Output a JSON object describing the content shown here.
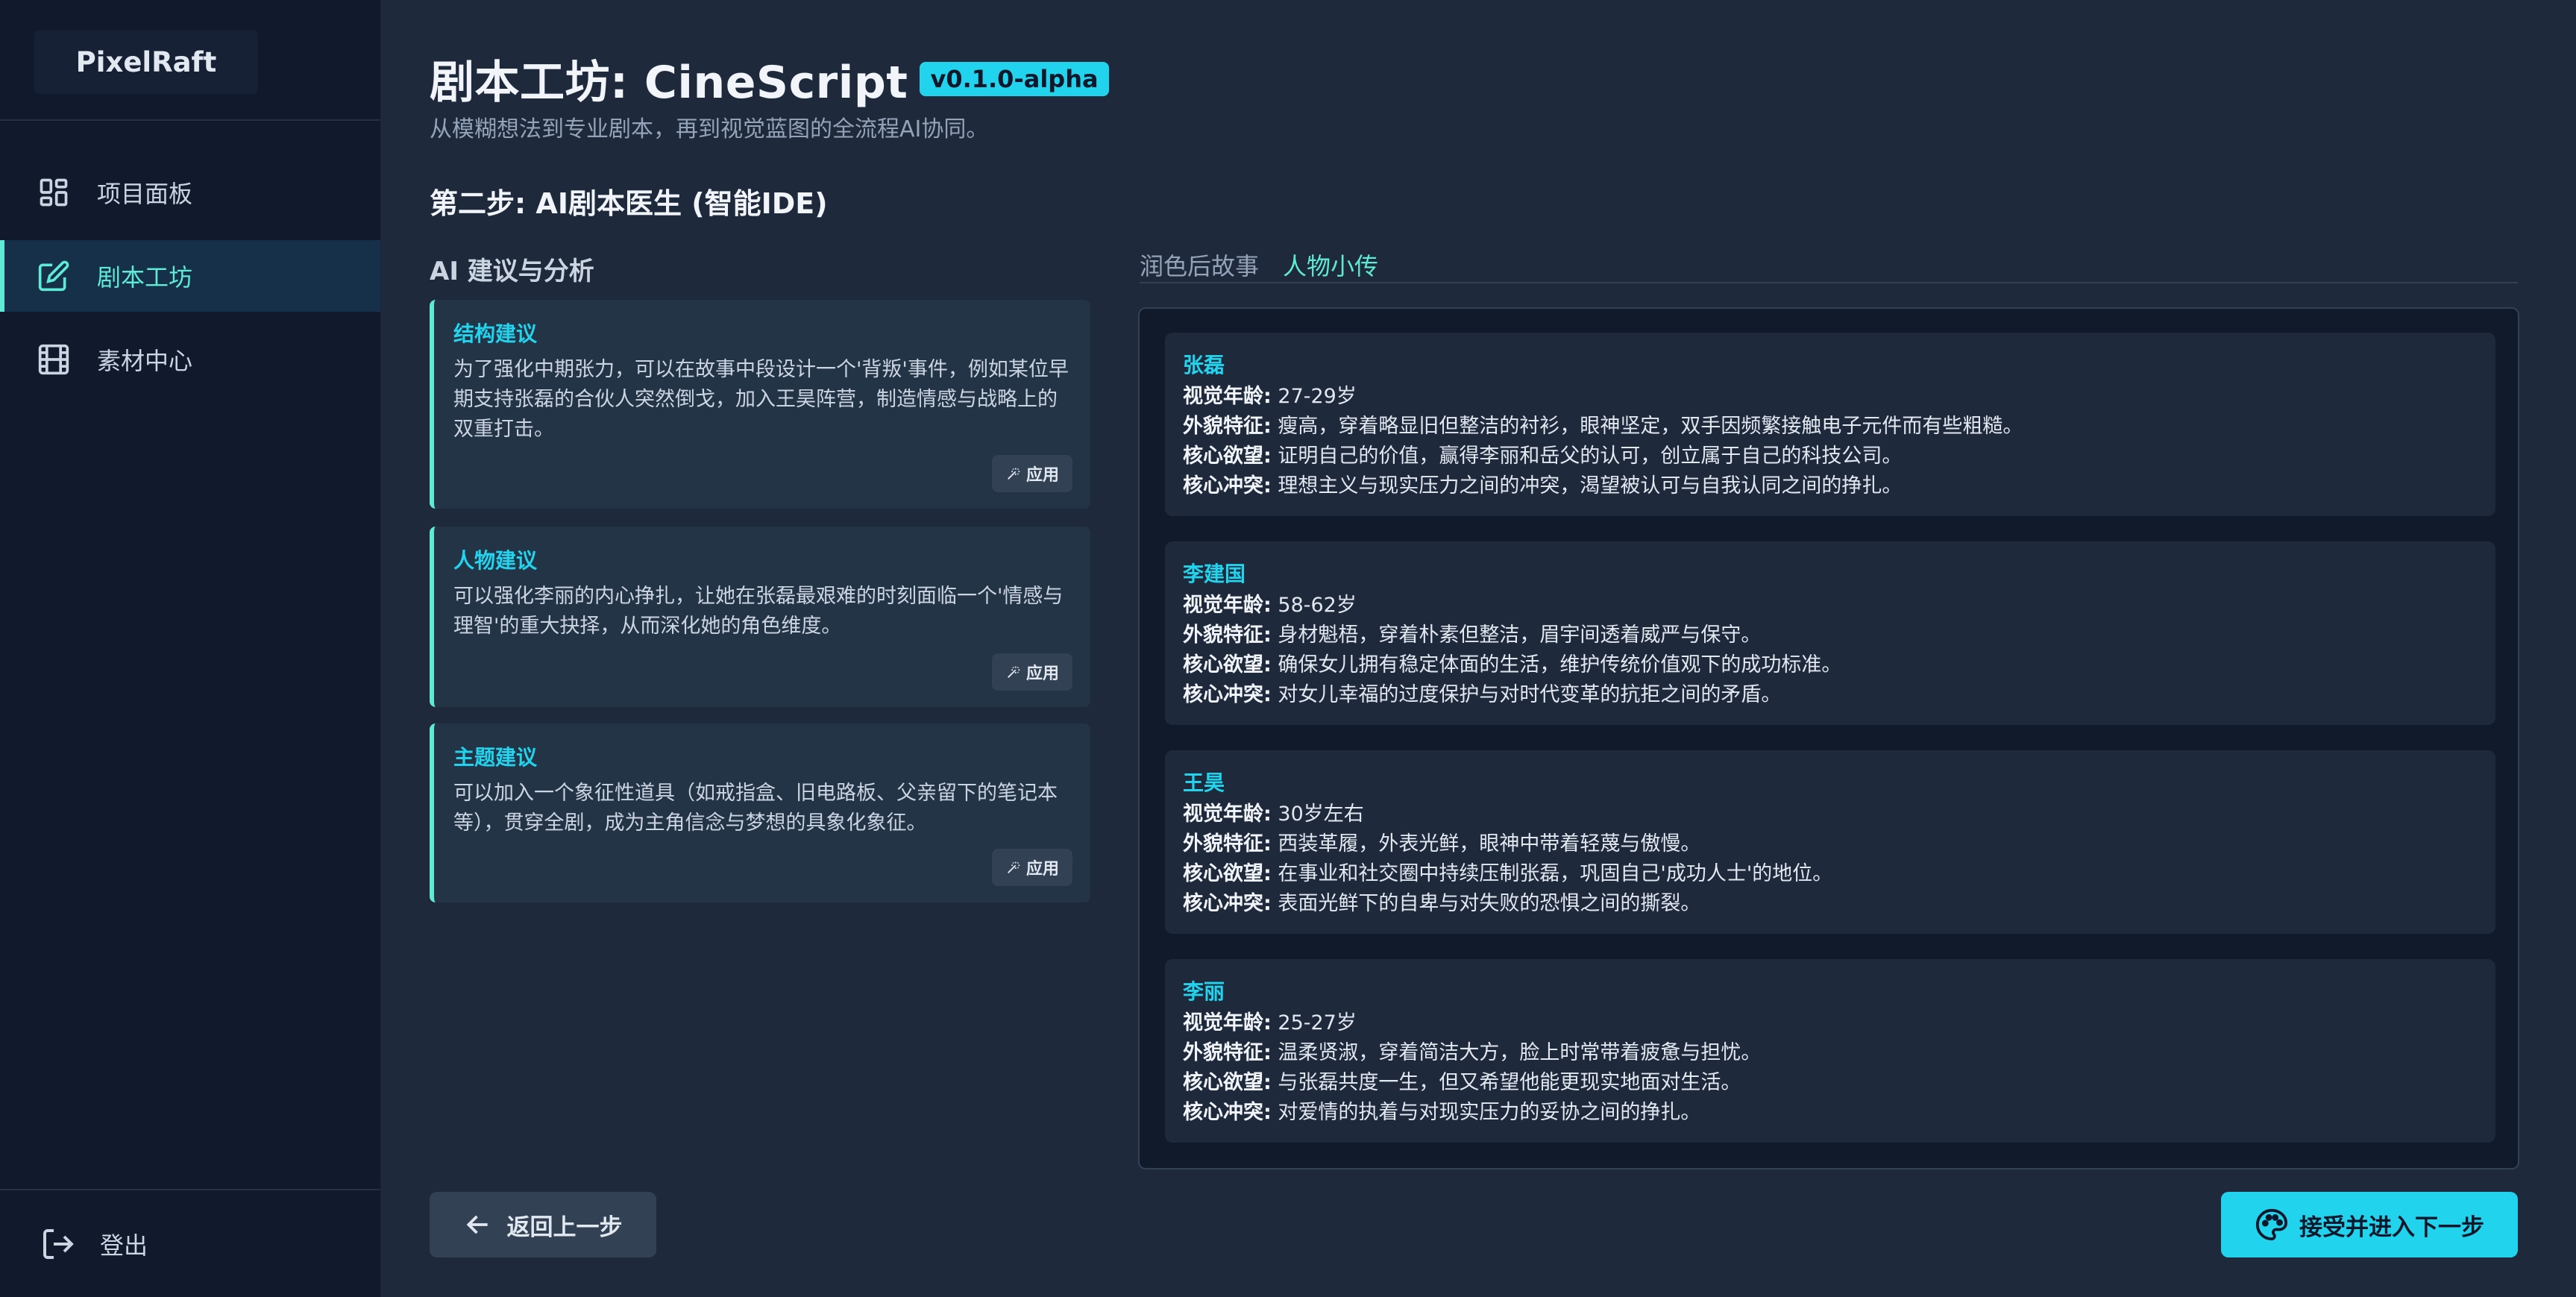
{
  "app": {
    "name": "PixelRaft"
  },
  "sidebar": {
    "items": [
      {
        "label": "项目面板",
        "icon": "dashboard-icon"
      },
      {
        "label": "剧本工坊",
        "icon": "edit-icon",
        "active": true
      },
      {
        "label": "素材中心",
        "icon": "film-icon"
      }
    ],
    "logout_label": "登出"
  },
  "header": {
    "title": "剧本工坊: CineScript",
    "version": "v0.1.0-alpha",
    "subtitle": "从模糊想法到专业剧本，再到视觉蓝图的全流程AI协同。"
  },
  "step": {
    "title": "第二步: AI剧本医生 (智能IDE)"
  },
  "suggestions": {
    "heading": "AI 建议与分析",
    "apply_label": "应用",
    "items": [
      {
        "title": "结构建议",
        "body": "为了强化中期张力，可以在故事中段设计一个'背叛'事件，例如某位早期支持张磊的合伙人突然倒戈，加入王昊阵营，制造情感与战略上的双重打击。"
      },
      {
        "title": "人物建议",
        "body": "可以强化李丽的内心挣扎，让她在张磊最艰难的时刻面临一个'情感与理智'的重大抉择，从而深化她的角色维度。"
      },
      {
        "title": "主题建议",
        "body": "可以加入一个象征性道具（如戒指盒、旧电路板、父亲留下的笔记本等），贯穿全剧，成为主角信念与梦想的具象化象征。"
      }
    ]
  },
  "tabs": [
    {
      "label": "润色后故事",
      "active": false
    },
    {
      "label": "人物小传",
      "active": true
    }
  ],
  "field_labels": {
    "age": "视觉年龄:",
    "look": "外貌特征:",
    "desire": "核心欲望:",
    "conflict": "核心冲突:"
  },
  "characters": [
    {
      "name": "张磊",
      "age": "27-29岁",
      "look": "瘦高，穿着略显旧但整洁的衬衫，眼神坚定，双手因频繁接触电子元件而有些粗糙。",
      "desire": "证明自己的价值，赢得李丽和岳父的认可，创立属于自己的科技公司。",
      "conflict": "理想主义与现实压力之间的冲突，渴望被认可与自我认同之间的挣扎。"
    },
    {
      "name": "李建国",
      "age": "58-62岁",
      "look": "身材魁梧，穿着朴素但整洁，眉宇间透着威严与保守。",
      "desire": "确保女儿拥有稳定体面的生活，维护传统价值观下的成功标准。",
      "conflict": "对女儿幸福的过度保护与对时代变革的抗拒之间的矛盾。"
    },
    {
      "name": "王昊",
      "age": "30岁左右",
      "look": "西装革履，外表光鲜，眼神中带着轻蔑与傲慢。",
      "desire": "在事业和社交圈中持续压制张磊，巩固自己'成功人士'的地位。",
      "conflict": "表面光鲜下的自卑与对失败的恐惧之间的撕裂。"
    },
    {
      "name": "李丽",
      "age": "25-27岁",
      "look": "温柔贤淑，穿着简洁大方，脸上时常带着疲惫与担忧。",
      "desire": "与张磊共度一生，但又希望他能更现实地面对生活。",
      "conflict": "对爱情的执着与对现实压力的妥协之间的挣扎。"
    }
  ],
  "footer": {
    "back_label": "返回上一步",
    "next_label": "接受并进入下一步"
  },
  "colors": {
    "accent": "#22d3ee",
    "accent_soft": "#5eead4",
    "background": "#1e293b",
    "sidebar": "#111a2c"
  }
}
